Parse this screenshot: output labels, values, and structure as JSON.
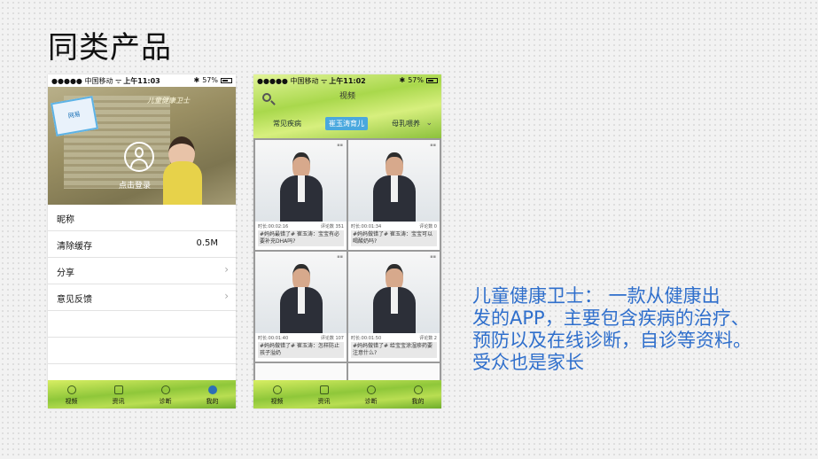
{
  "slide": {
    "title": "同类产品",
    "description_lines": [
      "儿童健康卫士： 一款从健康出",
      "发的APP，主要包含疾病的治疗、",
      "预防以及在线诊断，自诊等资料。",
      "受众也是家长"
    ]
  },
  "phone1": {
    "status": {
      "carrier": "●●●●● 中国移动 ᯤ",
      "time": "上午11:03",
      "battery": "57%"
    },
    "header": {
      "logo_text": "网易",
      "watermark": "儿童健康卫士",
      "login_label": "点击登录"
    },
    "menu": [
      {
        "label": "昵称",
        "value": ""
      },
      {
        "label": "清除缓存",
        "value": "0.5M"
      },
      {
        "label": "分享",
        "value": ""
      },
      {
        "label": "意见反馈",
        "value": ""
      }
    ],
    "tabs": [
      "视频",
      "资讯",
      "诊断",
      "我的"
    ]
  },
  "phone2": {
    "status": {
      "carrier": "●●●●● 中国移动 ᯤ",
      "time": "上午11:02",
      "battery": "57%"
    },
    "title": "视频",
    "category_tabs": [
      "常见疾病",
      "崔玉涛育儿",
      "母乳喂养"
    ],
    "videos": [
      {
        "duration": "时长:00:02:16",
        "comments": "评论数  351",
        "caption": "#妈妈最错了# 崔玉涛：宝宝有必要补充DHA吗?"
      },
      {
        "duration": "时长:00:01:34",
        "comments": "评论数  0",
        "caption": "#妈妈做错了# 崔玉涛：宝宝可以喝酸奶吗?"
      },
      {
        "duration": "时长:00:01:40",
        "comments": "评论数  107",
        "caption": "#妈妈做错了# 崔玉涛：怎样防止孩子溢奶"
      },
      {
        "duration": "时长:00:01:50",
        "comments": "评论数  2",
        "caption": "#妈妈做错了# 给宝宝涂湿疹药要注意什么?"
      }
    ],
    "tabs": [
      "视频",
      "资讯",
      "诊断",
      "我的"
    ]
  }
}
